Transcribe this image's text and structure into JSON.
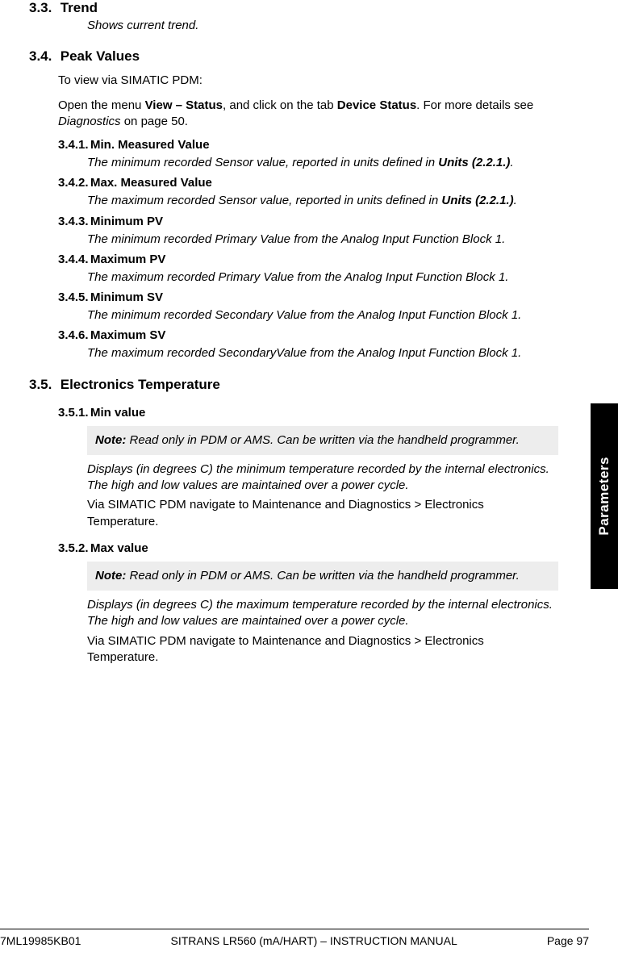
{
  "side_tab": "Parameters",
  "footer": {
    "left": "7ML19985KB01",
    "center": "SITRANS LR560 (mA/HART) – INSTRUCTION MANUAL",
    "right": "Page 97"
  },
  "s33": {
    "num": "3.3.",
    "title": "Trend",
    "desc": "Shows current trend."
  },
  "s34": {
    "num": "3.4.",
    "title": "Peak Values",
    "intro": "To view via SIMATIC PDM:",
    "p1a": "Open the menu ",
    "p1b": "View – Status",
    "p1c": ", and click on the tab ",
    "p1d": "Device Status",
    "p1e": ". For more details see ",
    "p1f": "Diagnostics",
    "p1g": " on page 50.",
    "i1": {
      "num": "3.4.1.",
      "title": "Min. Measured Value",
      "d1": "The minimum recorded Sensor value, reported in units defined in ",
      "d2": "Units (2.2.1.)",
      "d3": "."
    },
    "i2": {
      "num": "3.4.2.",
      "title": "Max. Measured Value",
      "d1": "The maximum recorded Sensor value, reported in units defined in ",
      "d2": "Units (2.2.1.)",
      "d3": "."
    },
    "i3": {
      "num": "3.4.3.",
      "title": "Minimum PV",
      "d": "The minimum recorded Primary Value from the Analog Input Function Block 1."
    },
    "i4": {
      "num": "3.4.4.",
      "title": "Maximum PV",
      "d": "The maximum recorded Primary Value from the Analog Input Function Block 1."
    },
    "i5": {
      "num": "3.4.5.",
      "title": "Minimum SV",
      "d": "The minimum recorded Secondary Value from the Analog Input Function Block 1."
    },
    "i6": {
      "num": "3.4.6.",
      "title": "Maximum SV",
      "d": "The maximum recorded SecondaryValue from the Analog Input Function Block 1."
    }
  },
  "s35": {
    "num": "3.5.",
    "title": "Electronics Temperature",
    "i1": {
      "num": "3.5.1.",
      "title": "Min value",
      "note_label": "Note:",
      "note_body": " Read only in PDM or AMS. Can be written via the handheld programmer.",
      "desc": "Displays (in degrees C) the minimum temperature recorded by the internal electronics. The high and low values are maintained over a power cycle.",
      "nav": "Via SIMATIC PDM navigate to Maintenance and Diagnostics > Electronics Temperature."
    },
    "i2": {
      "num": "3.5.2.",
      "title": "Max value",
      "note_label": "Note:",
      "note_body": " Read only in PDM or AMS. Can be written via the handheld programmer.",
      "desc": "Displays (in degrees C) the maximum temperature recorded by the internal electronics. The high and low values are maintained over a power cycle.",
      "nav": "Via SIMATIC PDM navigate to Maintenance and Diagnostics > Electronics Temperature."
    }
  }
}
